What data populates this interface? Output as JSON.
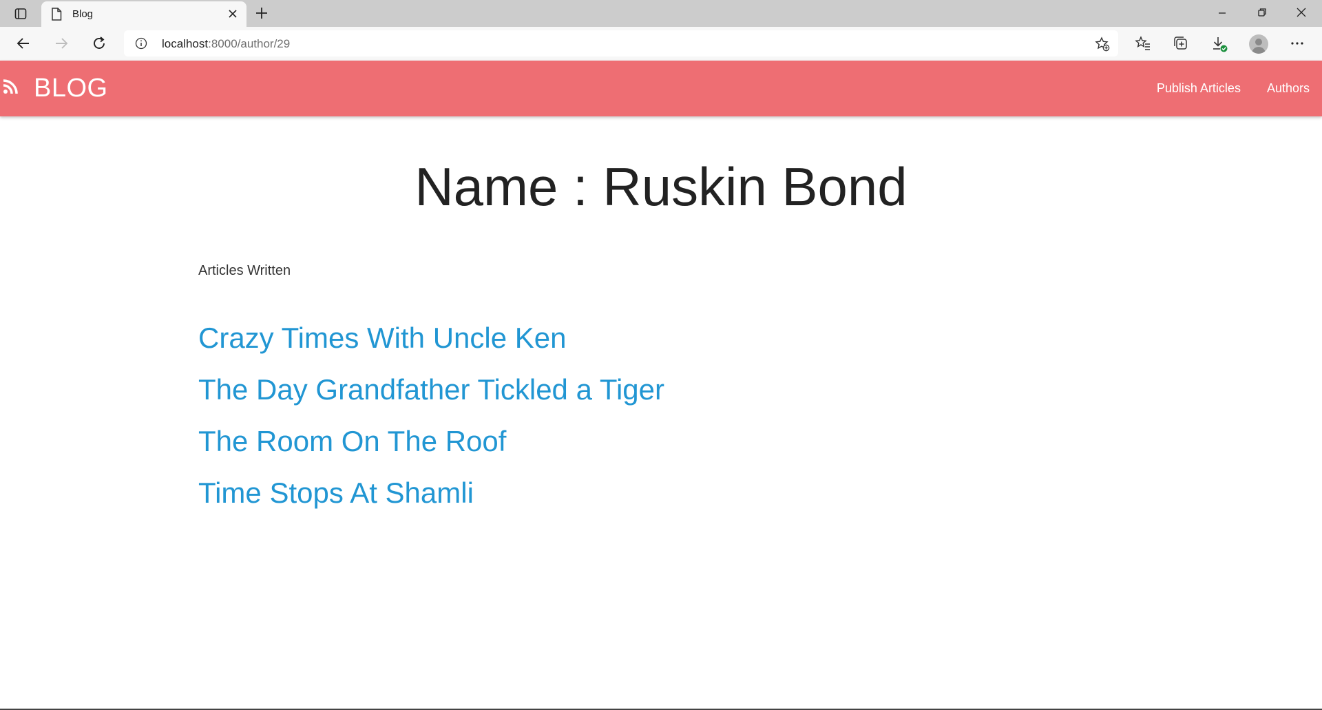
{
  "browser": {
    "tab_title": "Blog",
    "url_host": "localhost",
    "url_path": ":8000/author/29",
    "icons": [
      "tab-actions-icon",
      "page-icon",
      "close-icon",
      "plus-icon",
      "minimize-icon",
      "restore-icon",
      "window-close-icon",
      "back-arrow-icon",
      "forward-arrow-icon",
      "reload-icon",
      "info-icon",
      "favorite-add-icon",
      "favorites-icon",
      "collections-icon",
      "downloads-icon",
      "profile-icon",
      "more-icon"
    ]
  },
  "navbar": {
    "brand": "BLOG",
    "brand_icon": "rss-icon",
    "links": [
      "Publish Articles",
      "Authors"
    ],
    "color": "#ee6e73"
  },
  "author": {
    "heading": "Name : Ruskin Bond",
    "section_label": "Articles Written",
    "articles": [
      "Crazy Times With Uncle Ken",
      "The Day Grandfather Tickled a Tiger",
      "The Room On The Roof",
      "Time Stops At Shamli"
    ],
    "link_color": "#2196d3"
  }
}
